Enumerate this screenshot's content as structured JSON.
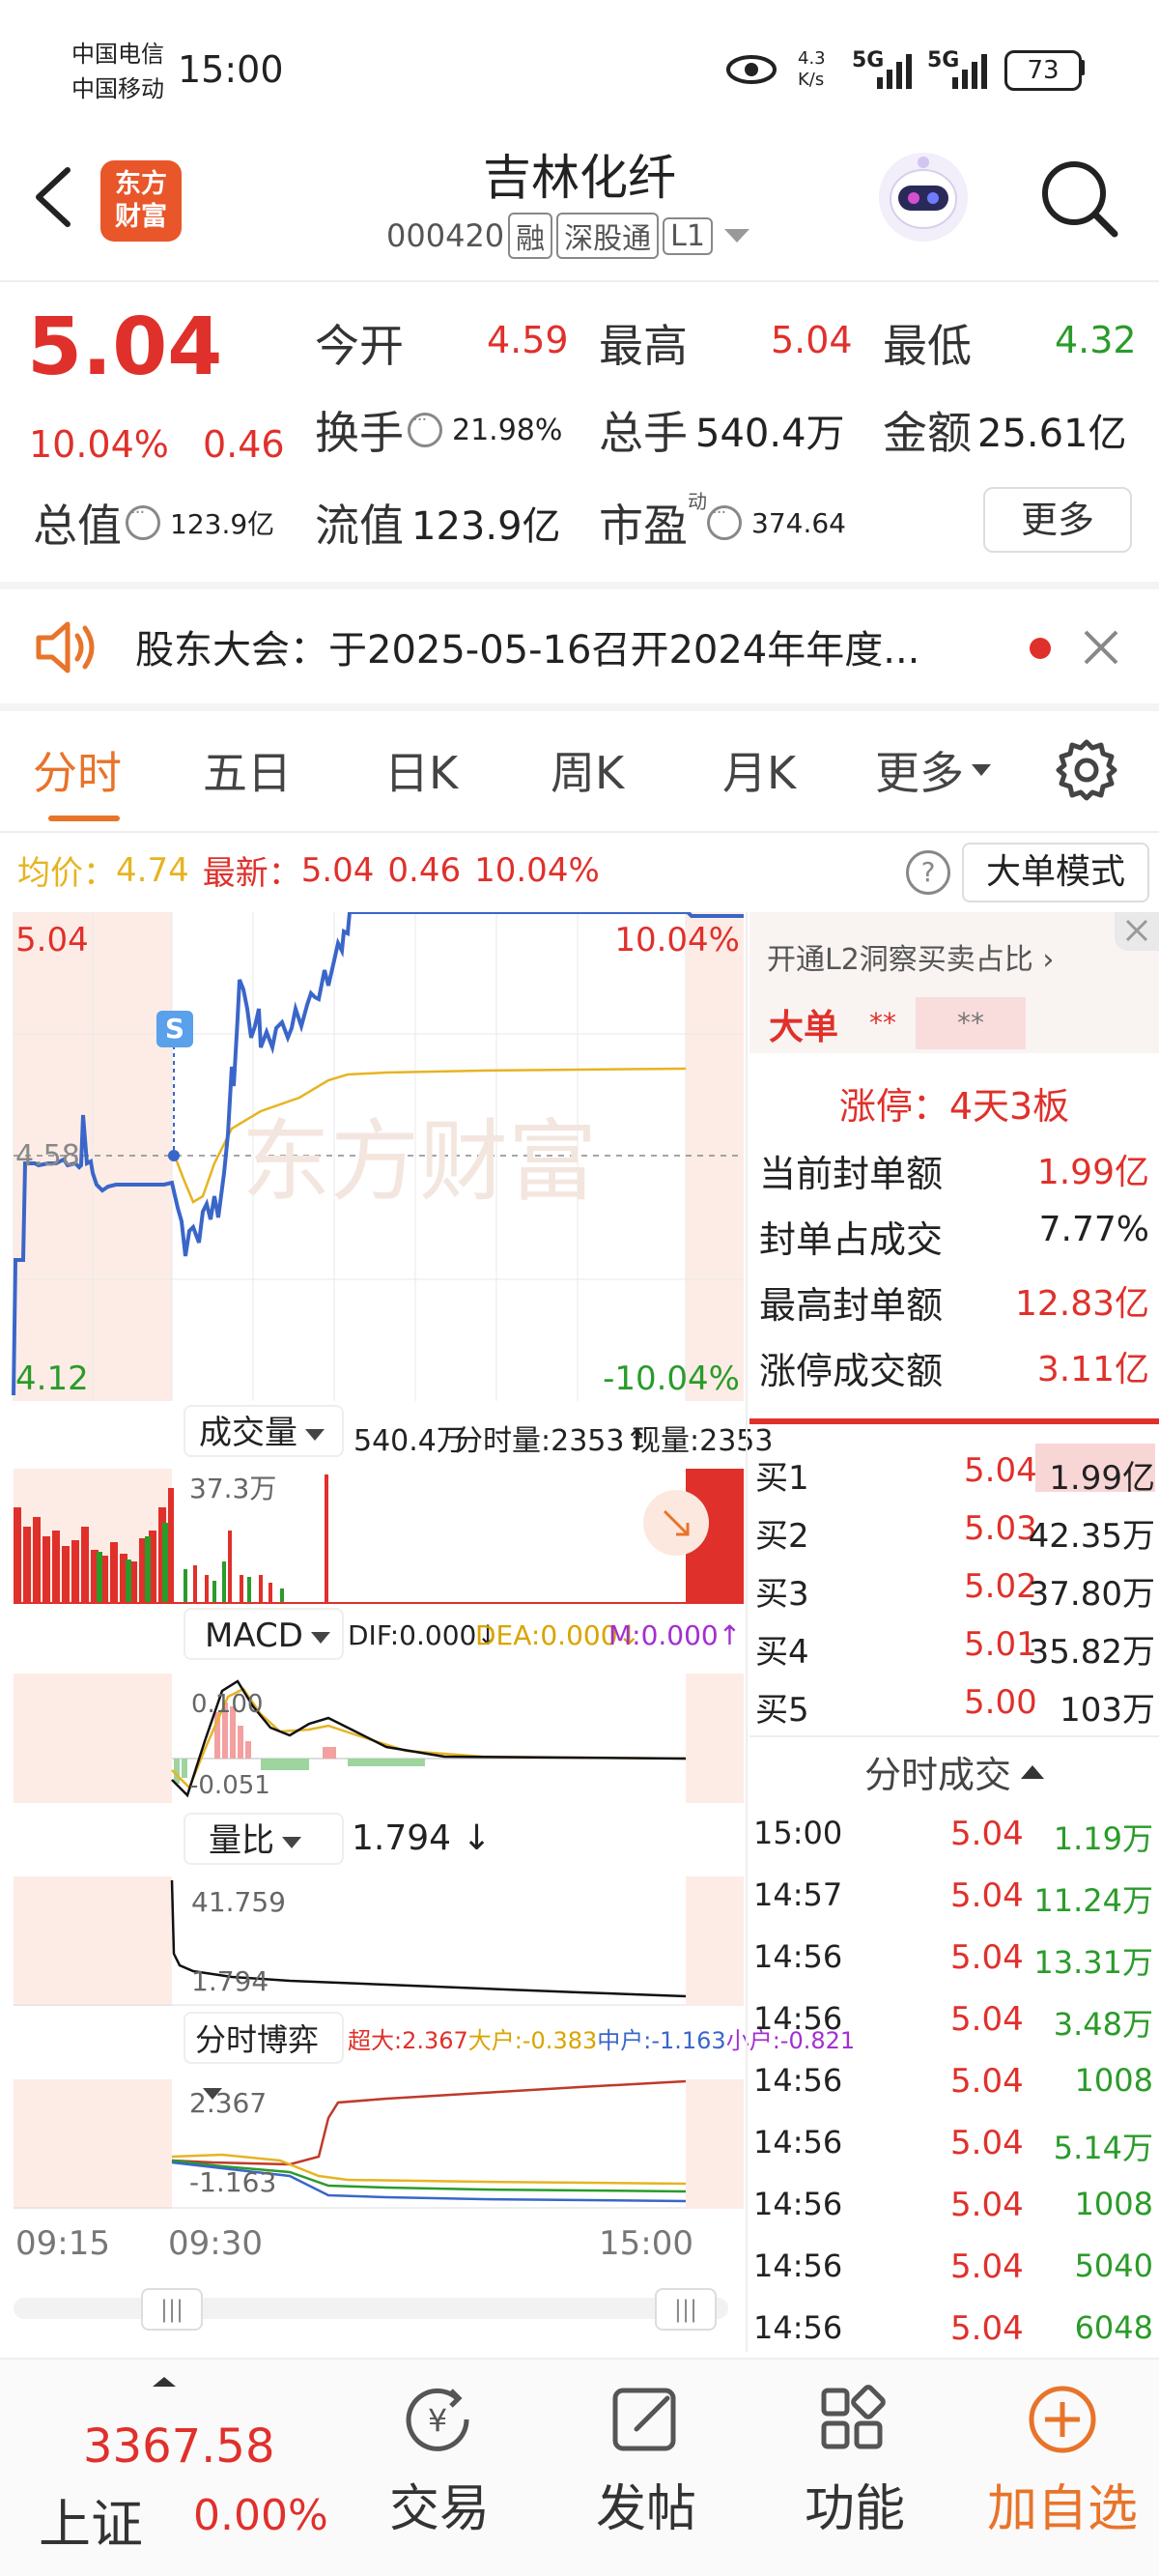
{
  "status_bar": {
    "carrier1": "中国电信",
    "carrier2": "中国移动",
    "time": "15:00",
    "net_speed_top": "4.3",
    "net_speed_bottom": "K/s",
    "signal1": "5G",
    "signal2": "5G",
    "battery": "73"
  },
  "header": {
    "logo_line1": "东方",
    "logo_line2": "财富",
    "stock_name": "吉林化纤",
    "stock_code": "000420",
    "tag1": "融",
    "tag2": "深股通",
    "tag3": "L1"
  },
  "quote": {
    "price": "5.04",
    "change_pct": "10.04%",
    "change_amt": "0.46",
    "open_label": "今开",
    "open": "4.59",
    "high_label": "最高",
    "high": "5.04",
    "low_label": "最低",
    "low": "4.32",
    "turnover_label": "换手",
    "turnover": "21.98%",
    "volume_label": "总手",
    "volume": "540.4万",
    "amount_label": "金额",
    "amount": "25.61亿",
    "mktcap_label": "总值",
    "mktcap": "123.9亿",
    "float_label": "流值",
    "float": "123.9亿",
    "pe_label": "市盈",
    "pe_sup": "动",
    "pe": "374.64",
    "more_button": "更多"
  },
  "notice": {
    "text": "股东大会：于2025-05-16召开2024年年度..."
  },
  "tabs": [
    {
      "label": "分时",
      "active": true
    },
    {
      "label": "五日"
    },
    {
      "label": "日K"
    },
    {
      "label": "周K"
    },
    {
      "label": "月K"
    },
    {
      "label": "更多"
    }
  ],
  "intraday_header": {
    "avg_label": "均价：",
    "avg": "4.74",
    "latest_label": "最新：",
    "latest": "5.04",
    "latest_chg": "0.46",
    "latest_pct": "10.04%",
    "mode_button": "大单模式"
  },
  "price_chart": {
    "top_left": "5.04",
    "top_right": "10.04%",
    "mid_left": "4.58",
    "bottom_left": "4.12",
    "bottom_right": "-10.04%",
    "s_marker": "S",
    "watermark": "东方财富"
  },
  "volume_panel": {
    "dropdown": "成交量",
    "total": "540.4万",
    "tick_label": "分时量:2353",
    "now_label": "现量:2353",
    "max_label": "37.3万"
  },
  "macd_panel": {
    "dropdown": "MACD",
    "dif": "DIF:0.000",
    "dea": "DEA:0.000",
    "m": "M:0.000",
    "top_label": "0.100",
    "bottom_label": "-0.051"
  },
  "ratio_panel": {
    "dropdown": "量比",
    "value": "1.794",
    "top_label": "41.759",
    "bottom_label": "1.794"
  },
  "game_panel": {
    "dropdown": "分时博弈",
    "super": "超大:2.367",
    "large": "大户:-0.383",
    "mid": "中户:-1.163",
    "small": "小户:-0.821",
    "top_label": "2.367",
    "bottom_label": "-1.163"
  },
  "time_axis": {
    "t1": "09:15",
    "t2": "09:30",
    "t3": "15:00"
  },
  "side_panel": {
    "l2_link": "开通L2洞察买卖占比",
    "big_order_label": "大单",
    "big_order_val1": "**",
    "big_order_val2": "**",
    "limit_up_label": "涨停：4天3板",
    "rows": [
      {
        "label": "当前封单额",
        "value": "1.99亿"
      },
      {
        "label": "封单占成交",
        "value": "7.77%"
      },
      {
        "label": "最高封单额",
        "value": "12.83亿"
      },
      {
        "label": "涨停成交额",
        "value": "3.11亿"
      }
    ],
    "bids": [
      {
        "label": "买1",
        "price": "5.04",
        "vol": "1.99亿"
      },
      {
        "label": "买2",
        "price": "5.03",
        "vol": "42.35万"
      },
      {
        "label": "买3",
        "price": "5.02",
        "vol": "37.80万"
      },
      {
        "label": "买4",
        "price": "5.01",
        "vol": "35.82万"
      },
      {
        "label": "买5",
        "price": "5.00",
        "vol": "103万"
      }
    ],
    "trades_title": "分时成交",
    "trades": [
      {
        "time": "15:00",
        "price": "5.04",
        "vol": "1.19万"
      },
      {
        "time": "14:57",
        "price": "5.04",
        "vol": "11.24万"
      },
      {
        "time": "14:56",
        "price": "5.04",
        "vol": "13.31万"
      },
      {
        "time": "14:56",
        "price": "5.04",
        "vol": "3.48万"
      },
      {
        "time": "14:56",
        "price": "5.04",
        "vol": "1008"
      },
      {
        "time": "14:56",
        "price": "5.04",
        "vol": "5.14万"
      },
      {
        "time": "14:56",
        "price": "5.04",
        "vol": "1008"
      },
      {
        "time": "14:56",
        "price": "5.04",
        "vol": "5040"
      },
      {
        "time": "14:56",
        "price": "5.04",
        "vol": "6048"
      }
    ]
  },
  "bottom_nav": {
    "index_value": "3367.58",
    "index_name": "上证",
    "index_pct": "0.00%",
    "trade": "交易",
    "post": "发帖",
    "func": "功能",
    "add": "加自选"
  },
  "colors": {
    "up": "#e0302b",
    "down": "#2a9b2a",
    "accent": "#e8742a",
    "price_line": "#3a66c9",
    "avg_line": "#e6b422"
  },
  "chart_data": {
    "type": "line",
    "x": [
      "09:15",
      "09:30",
      "15:00"
    ],
    "ylim": [
      4.12,
      5.04
    ],
    "series": [
      {
        "name": "最新",
        "values": [
          4.58,
          4.32,
          5.04
        ]
      },
      {
        "name": "均价",
        "values": [
          4.58,
          4.5,
          4.74
        ]
      }
    ]
  }
}
